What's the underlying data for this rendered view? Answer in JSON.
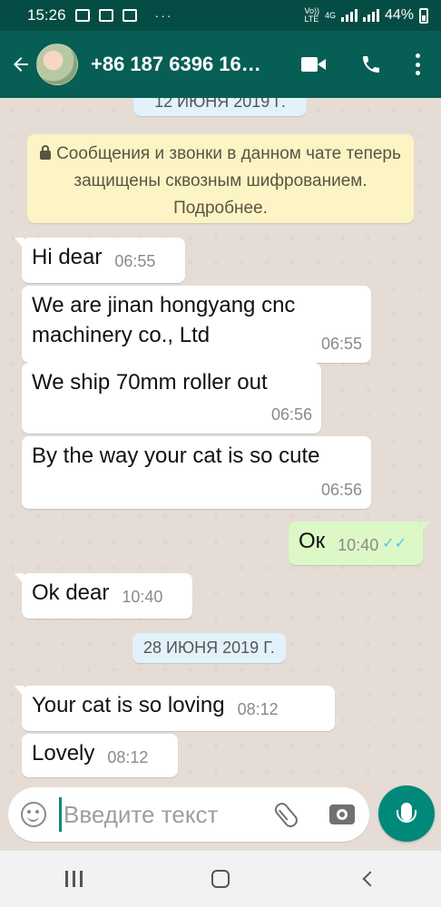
{
  "status_bar": {
    "time": "15:26",
    "notification_dots": "···",
    "network_label_top": "Vo))",
    "network_label_bottom": "LTE",
    "network_type": "4G",
    "battery_percent": "44%"
  },
  "header": {
    "contact_name": "+86 187 6396 16…",
    "icons": [
      "back-arrow-icon",
      "video-call-icon",
      "voice-call-icon",
      "more-options-icon"
    ]
  },
  "chat": {
    "date_top": "12 ИЮНЯ 2019 Г.",
    "encryption_notice": "Сообщения и звонки в данном чате теперь защищены сквозным шифрованием. Подробнее.",
    "messages": [
      {
        "direction": "in",
        "text": "Hi dear",
        "time": "06:55"
      },
      {
        "direction": "in",
        "text": "We are jinan hongyang cnc machinery co., Ltd",
        "time": "06:55"
      },
      {
        "direction": "in",
        "text": "We ship 70mm roller out",
        "time": "06:56"
      },
      {
        "direction": "in",
        "text": "By the way your cat is so cute",
        "time": "06:56"
      },
      {
        "direction": "out",
        "text": "Ок",
        "time": "10:40",
        "read_ticks": "✓✓"
      },
      {
        "direction": "in",
        "text": "Ok dear",
        "time": "10:40"
      },
      {
        "direction": "in",
        "text": "Your cat is so loving",
        "time": "08:12"
      },
      {
        "direction": "in",
        "text": "Lovely",
        "time": "08:12"
      }
    ],
    "date_middle": "28 ИЮНЯ 2019 Г."
  },
  "composer": {
    "placeholder": "Введите текст"
  },
  "colors": {
    "status_bar": "#054d44",
    "app_bar": "#075e54",
    "chat_background": "#e5ddd5",
    "outgoing_bubble": "#dcf8c6",
    "encryption_banner": "#fdf4c5",
    "mic_button": "#00897b",
    "read_ticks": "#4fc3f7"
  }
}
